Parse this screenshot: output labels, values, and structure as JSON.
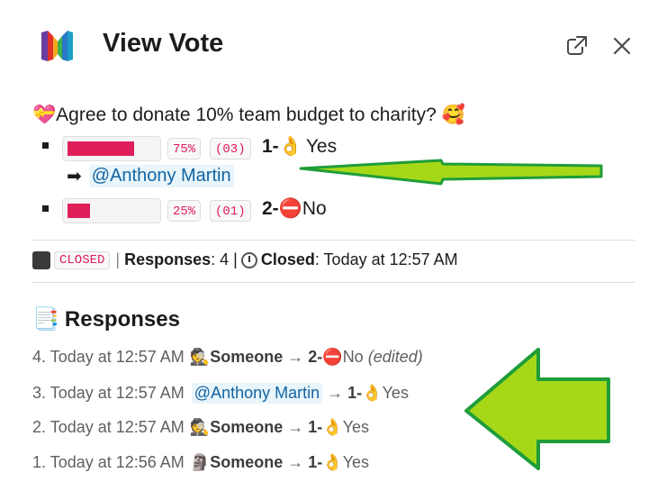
{
  "header": {
    "title": "View Vote"
  },
  "poll": {
    "question_emoji_left": "💝",
    "question": "Agree to donate 10% team budget to charity?",
    "question_emoji_right": "🥰",
    "options": [
      {
        "percent_label": "75%",
        "count_label": "(03)",
        "number": "1-",
        "emoji": "👌",
        "label": "Yes",
        "fill_fraction": 0.75,
        "voter_arrow": "➡",
        "voter": "@Anthony Martin"
      },
      {
        "percent_label": "25%",
        "count_label": "(01)",
        "number": "2-",
        "emoji": "⛔",
        "label": "No",
        "fill_fraction": 0.25
      }
    ]
  },
  "status": {
    "closed_badge": "CLOSED",
    "responses_label": "Responses",
    "responses_count": ": 4 |",
    "closed_label": "Closed",
    "closed_time": ": Today at 12:57 AM"
  },
  "responses": {
    "title_emoji": "📑",
    "title": "Responses",
    "rows": [
      {
        "prefix": "4. Today at 12:57 AM",
        "avatar": "🕵",
        "user": "Someone",
        "arrow": "→",
        "number": "2-",
        "emoji": "⛔",
        "label": "No",
        "note": "(edited)"
      },
      {
        "prefix": "3. Today at 12:57 AM",
        "mention": "@Anthony Martin",
        "arrow": "→",
        "number": "1-",
        "emoji": "👌",
        "label": "Yes"
      },
      {
        "prefix": "2. Today at 12:57 AM",
        "avatar": "🕵",
        "user": "Someone",
        "arrow": "→",
        "number": "1-",
        "emoji": "👌",
        "label": "Yes"
      },
      {
        "prefix": "1. Today at 12:56 AM",
        "avatar": "🗿",
        "user": "Someone",
        "arrow": "→",
        "number": "1-",
        "emoji": "👌",
        "label": "Yes"
      }
    ]
  },
  "colors": {
    "accent": "#e01e5a",
    "mention": "#1264a3",
    "annotation_arrow": "#a6d818",
    "annotation_border": "#1f9d3a"
  },
  "icons": {
    "logo": "app-logo-icon",
    "external": "external-link-icon",
    "close": "close-icon"
  }
}
